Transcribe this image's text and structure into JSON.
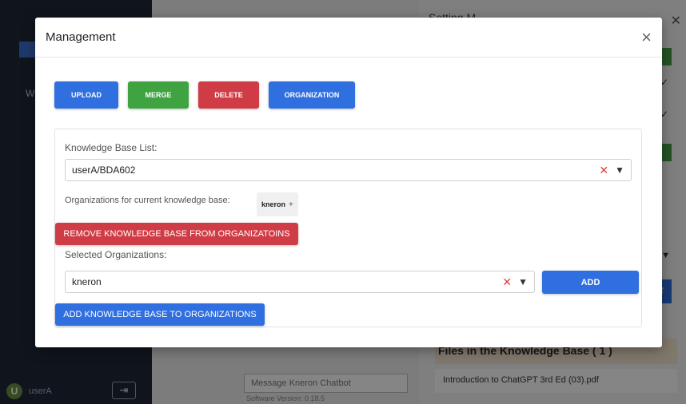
{
  "background": {
    "sidebar_letter": "W",
    "user": {
      "avatar_initial": "U",
      "name": "userA"
    },
    "logout_glyph": "⇥",
    "message_placeholder": "Message Kneron Chatbot",
    "software_version": "Software Version: 0.18.5",
    "right_panel_title": "Setting M",
    "files_header": "Files in the Knowledge Base ( 1 )",
    "files": [
      "Introduction to ChatGPT 3rd Ed (03).pdf"
    ],
    "check_glyph": "✓",
    "caret_glyph": "▼",
    "blue_button_text": "T",
    "close_glyph": "✕"
  },
  "modal": {
    "title": "Management",
    "close_glyph": "×",
    "buttons": {
      "upload": "UPLOAD",
      "merge": "MERGE",
      "delete": "DELETE",
      "organization": "ORGANIZATION"
    },
    "kb_list": {
      "label": "Knowledge Base List:",
      "value": "userA/BDA602",
      "clear_glyph": "✕",
      "caret_glyph": "▼"
    },
    "orgs_current": {
      "label": "Organizations for current knowledge base:",
      "tags": [
        {
          "name": "kneron",
          "plus": "+"
        }
      ]
    },
    "remove_button": "REMOVE KNOWLEDGE BASE FROM ORGANIZATOINS",
    "selected_orgs": {
      "label": "Selected Organizations:",
      "value": "kneron",
      "clear_glyph": "✕",
      "caret_glyph": "▼"
    },
    "add_button": "ADD",
    "add_to_orgs_button": "ADD KNOWLEDGE BASE TO ORGANIZATIONS"
  },
  "colors": {
    "primary_blue": "#2f6fe0",
    "success_green": "#3fa342",
    "danger_red": "#d03c45"
  }
}
